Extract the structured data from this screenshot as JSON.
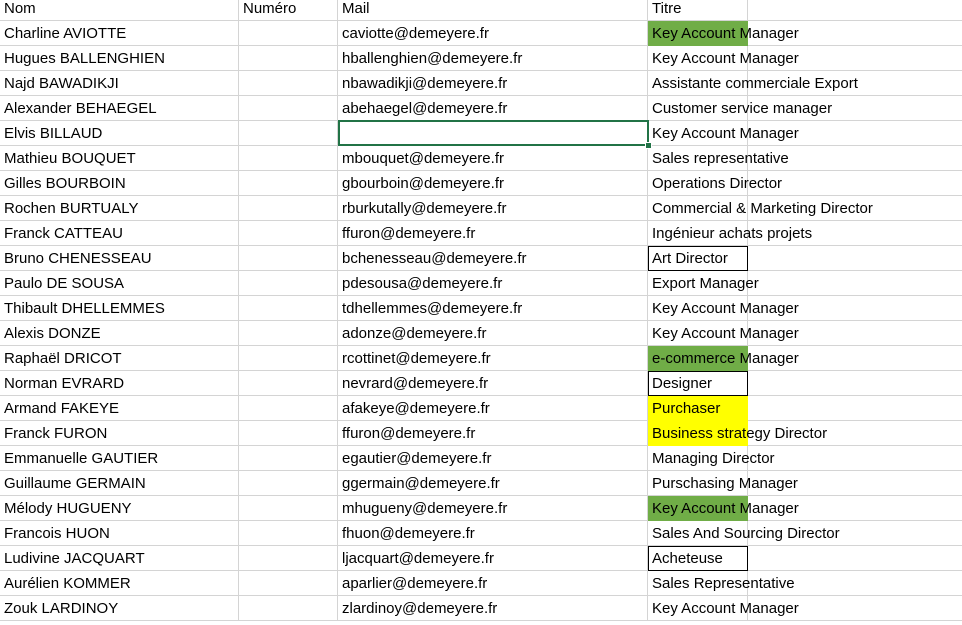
{
  "headers": [
    "Nom",
    "Numéro",
    "Mail",
    "Titre"
  ],
  "rows": [
    {
      "nom": "Charline AVIOTTE",
      "mail": "caviotte@demeyere.fr",
      "titre": "Key Account Manager",
      "fill": "green"
    },
    {
      "nom": "Hugues BALLENGHIEN",
      "mail": "hballenghien@demeyere.fr",
      "titre": "Key Account Manager",
      "fill": "none"
    },
    {
      "nom": "Najd BAWADIKJI",
      "mail": "nbawadikji@demeyere.fr",
      "titre": "Assistante commerciale Export",
      "fill": "none"
    },
    {
      "nom": "Alexander BEHAEGEL",
      "mail": "abehaegel@demeyere.fr",
      "titre": "Customer service manager",
      "fill": "none"
    },
    {
      "nom": "Elvis BILLAUD",
      "mail": "",
      "titre": "Key Account Manager",
      "fill": "none"
    },
    {
      "nom": "Mathieu BOUQUET",
      "mail": "mbouquet@demeyere.fr",
      "titre": "Sales representative",
      "fill": "none"
    },
    {
      "nom": "Gilles BOURBOIN",
      "mail": "gbourboin@demeyere.fr",
      "titre": "Operations Director",
      "fill": "none"
    },
    {
      "nom": "Rochen BURTUALY",
      "mail": "rburkutally@demeyere.fr",
      "titre": "Commercial & Marketing Director",
      "fill": "none"
    },
    {
      "nom": "Franck CATTEAU",
      "mail": "ffuron@demeyere.fr",
      "titre": "Ingénieur achats projets",
      "fill": "none"
    },
    {
      "nom": "Bruno CHENESSEAU",
      "mail": "bchenesseau@demeyere.fr",
      "titre": "Art Director",
      "fill": "white-boxed"
    },
    {
      "nom": "Paulo DE SOUSA",
      "mail": "pdesousa@demeyere.fr",
      "titre": "Export Manager",
      "fill": "none"
    },
    {
      "nom": "Thibault DHELLEMMES",
      "mail": "tdhellemmes@demeyere.fr",
      "titre": "Key Account Manager",
      "fill": "none"
    },
    {
      "nom": "Alexis DONZE",
      "mail": "adonze@demeyere.fr",
      "titre": "Key Account Manager",
      "fill": "none"
    },
    {
      "nom": "Raphaël DRICOT",
      "mail": "rcottinet@demeyere.fr",
      "titre": "e-commerce Manager",
      "fill": "green"
    },
    {
      "nom": "Norman EVRARD",
      "mail": "nevrard@demeyere.fr",
      "titre": "Designer",
      "fill": "white-boxed"
    },
    {
      "nom": "Armand FAKEYE",
      "mail": "afakeye@demeyere.fr",
      "titre": "Purchaser",
      "fill": "yellow"
    },
    {
      "nom": "Franck FURON",
      "mail": "ffuron@demeyere.fr",
      "titre": "Business strategy Director",
      "fill": "yellow"
    },
    {
      "nom": "Emmanuelle GAUTIER",
      "mail": "egautier@demeyere.fr",
      "titre": "Managing Director",
      "fill": "none"
    },
    {
      "nom": "Guillaume GERMAIN",
      "mail": "ggermain@demeyere.fr",
      "titre": "Purschasing Manager",
      "fill": "none"
    },
    {
      "nom": "Mélody HUGUENY",
      "mail": "mhugueny@demeyere.fr",
      "titre": "Key Account Manager",
      "fill": "green"
    },
    {
      "nom": "Francois HUON",
      "mail": "fhuon@demeyere.fr",
      "titre": "Sales And Sourcing Director",
      "fill": "none"
    },
    {
      "nom": "Ludivine JACQUART",
      "mail": "ljacquart@demeyere.fr",
      "titre": "Acheteuse",
      "fill": "white-boxed"
    },
    {
      "nom": "Aurélien KOMMER",
      "mail": "aparlier@demeyere.fr",
      "titre": "Sales Representative",
      "fill": "none"
    },
    {
      "nom": "Zouk LARDINOY",
      "mail": "zlardinoy@demeyere.fr",
      "titre": "Key Account Manager",
      "fill": "none"
    }
  ],
  "selected_cell": {
    "row": 4,
    "column": "Mail"
  },
  "colors": {
    "green": "#70ad47",
    "yellow": "#ffff00",
    "selection": "#217346",
    "gridline": "#d4d4d4"
  }
}
